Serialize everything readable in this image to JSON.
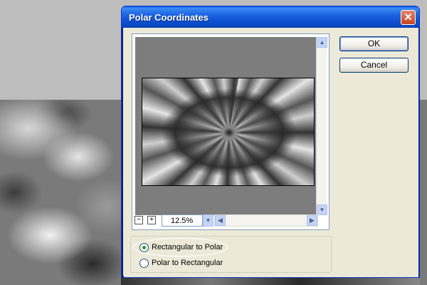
{
  "dialog": {
    "title": "Polar Coordinates",
    "close_icon": "close-icon"
  },
  "buttons": {
    "ok_label": "OK",
    "cancel_label": "Cancel"
  },
  "zoom": {
    "value": "12.5%",
    "zoom_out_label": "−",
    "zoom_in_label": "+"
  },
  "options": {
    "selected": "rectangular_to_polar",
    "rectangular_to_polar": "Rectangular to Polar",
    "polar_to_rectangular": "Polar to Rectangular"
  },
  "colors": {
    "titlebar": "#0d4fd0",
    "close_button": "#c9441f",
    "radio_selected": "#21a121"
  }
}
